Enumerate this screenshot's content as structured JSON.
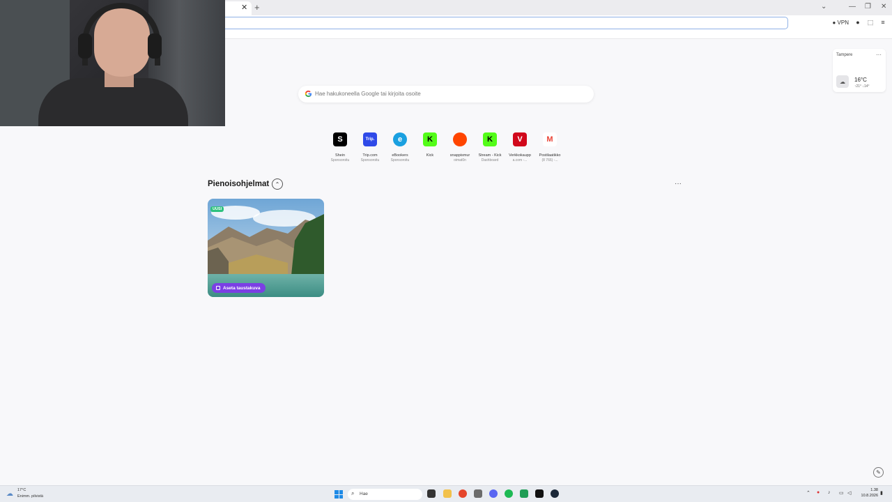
{
  "browser": {
    "tab_close": "✕",
    "new_tab": "+",
    "window_controls": [
      "⌄",
      "—",
      "❐",
      "✕"
    ],
    "toolbar": {
      "vpn_label": "VPN"
    }
  },
  "weather_widget": {
    "city": "Tampere",
    "more": "···",
    "temperature": "16°C",
    "high": "↑21°",
    "low": "↓14°"
  },
  "search": {
    "placeholder": "Hae hakukoneella Google tai kirjoita osoite"
  },
  "speed_dials": [
    {
      "name": "Shein",
      "sub": "Sponsoroitu",
      "glyph": "S",
      "color": "#000000"
    },
    {
      "name": "Trip.com",
      "sub": "Sponsoroitu",
      "glyph": "Trip.",
      "color": "#2f4ae8"
    },
    {
      "name": "eBookers",
      "sub": "Sponsoroitu",
      "glyph": "e",
      "color": "#1aa0e0"
    },
    {
      "name": "Kick",
      "sub": "",
      "glyph": "K",
      "color": "#53fc18"
    },
    {
      "name": "snappismur",
      "sub": "oimat0n",
      "glyph": "●",
      "color": "#ff4500"
    },
    {
      "name": "Stream - Kick",
      "sub": "Dashboard",
      "glyph": "K",
      "color": "#53fc18"
    },
    {
      "name": "Verkkokaupp",
      "sub": "a.com -...",
      "glyph": "V",
      "color": "#d1081b"
    },
    {
      "name": "Postilaatikko",
      "sub": "(8 766) -...",
      "glyph": "M",
      "color": "#ea4335"
    }
  ],
  "widgets_section": {
    "title": "Pienoisohjelmat",
    "collapse": "⌃",
    "more": "···",
    "wallpaper_card": {
      "badge": "UUSI",
      "button": "Aseta taustakuva"
    }
  },
  "edit": "✎",
  "taskbar": {
    "weather_temp": "17°C",
    "weather_cond": "Enimm. pilvistä",
    "search": "Hae",
    "time": "1.38",
    "date": "10.8.2026"
  }
}
